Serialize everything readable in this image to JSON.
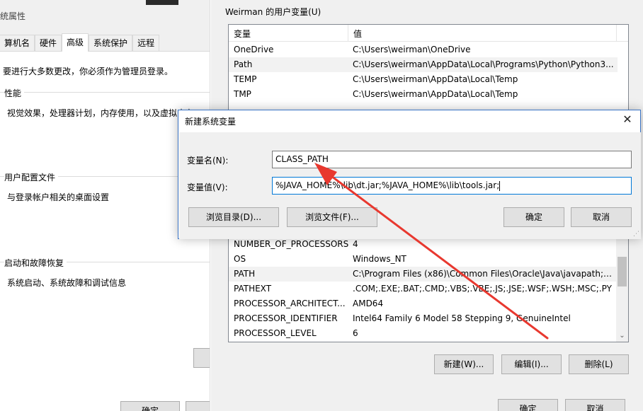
{
  "system_properties": {
    "title": "统属性",
    "tabs": [
      {
        "label": "算机名",
        "active": false
      },
      {
        "label": "硬件",
        "active": false
      },
      {
        "label": "高级",
        "active": true
      },
      {
        "label": "系统保护",
        "active": false
      },
      {
        "label": "远程",
        "active": false
      }
    ],
    "notice": "要进行大多数更改，你必须作为管理员登录。",
    "performance": {
      "title": "性能",
      "desc": "视觉效果，处理器计划，内存使用，以及虚拟内存"
    },
    "user_profiles": {
      "title": "用户配置文件",
      "desc": "与登录帐户相关的桌面设置"
    },
    "startup_recovery": {
      "title": "启动和故障恢复",
      "desc": "系统启动、系统故障和调试信息"
    },
    "ok_label": "确定"
  },
  "env_vars": {
    "user_vars_label": "Weirman 的用户变量(U)",
    "col_var": "变量",
    "col_value": "值",
    "user_rows": [
      {
        "name": "OneDrive",
        "value": "C:\\Users\\weirman\\OneDrive"
      },
      {
        "name": "Path",
        "value": "C:\\Users\\weirman\\AppData\\Local\\Programs\\Python\\Python3..."
      },
      {
        "name": "TEMP",
        "value": "C:\\Users\\weirman\\AppData\\Local\\Temp"
      },
      {
        "name": "TMP",
        "value": "C:\\Users\\weirman\\AppData\\Local\\Temp"
      }
    ],
    "system_rows": [
      {
        "name": "NUMBER_OF_PROCESSORS",
        "value": "4"
      },
      {
        "name": "OS",
        "value": "Windows_NT"
      },
      {
        "name": "PATH",
        "value": "C:\\Program Files (x86)\\Common Files\\Oracle\\Java\\javapath;%..."
      },
      {
        "name": "PATHEXT",
        "value": ".COM;.EXE;.BAT;.CMD;.VBS;.VBE;.JS;.JSE;.WSF;.WSH;.MSC;.PY"
      },
      {
        "name": "PROCESSOR_ARCHITECT...",
        "value": "AMD64"
      },
      {
        "name": "PROCESSOR_IDENTIFIER",
        "value": "Intel64 Family 6 Model 58 Stepping 9, GenuineIntel"
      },
      {
        "name": "PROCESSOR_LEVEL",
        "value": "6"
      }
    ],
    "new_label": "新建(W)...",
    "edit_label": "编辑(I)...",
    "delete_label": "删除(L)",
    "ok_label": "确定",
    "cancel_label": "取消"
  },
  "new_var_dialog": {
    "title": "新建系统变量",
    "close_glyph": "✕",
    "name_label": "变量名(N):",
    "name_value": "CLASS_PATH",
    "value_label": "变量值(V):",
    "value_value": "%JAVA_HOME%\\lib\\dt.jar;%JAVA_HOME%\\lib\\tools.jar;",
    "browse_dir_label": "浏览目录(D)...",
    "browse_file_label": "浏览文件(F)...",
    "ok_label": "确定",
    "cancel_label": "取消"
  },
  "colors": {
    "accent": "#0078d7",
    "annotation_arrow": "#e8382f"
  }
}
